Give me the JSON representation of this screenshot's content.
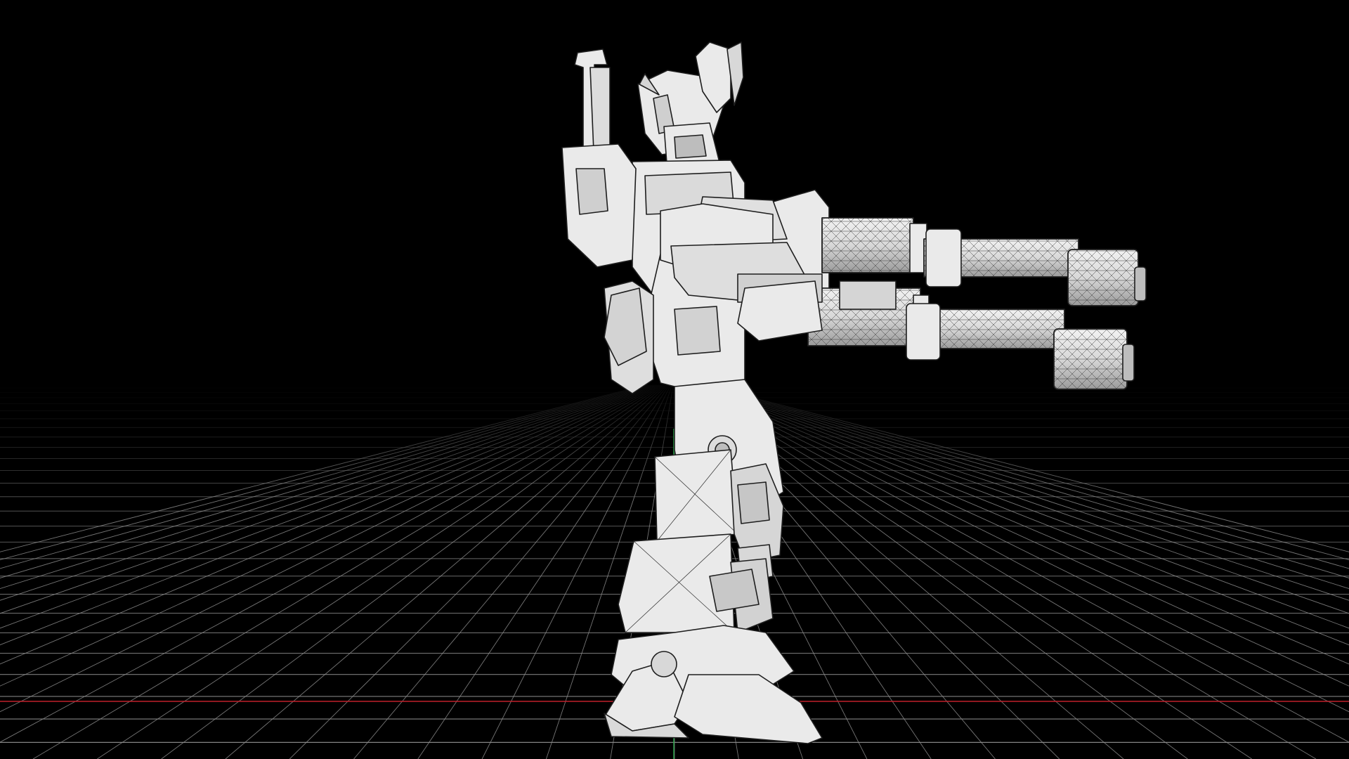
{
  "viewport": {
    "background_color": "#000000",
    "grid_color": "#8a8a8a",
    "x_axis_color": "#c0202a",
    "y_axis_color": "#2aa84a",
    "model_fill": "#eaeaea",
    "model_shade": "#cfcfcf",
    "wire_color": "#1e1e1e",
    "display_mode": "wireframe-on-shaded"
  }
}
